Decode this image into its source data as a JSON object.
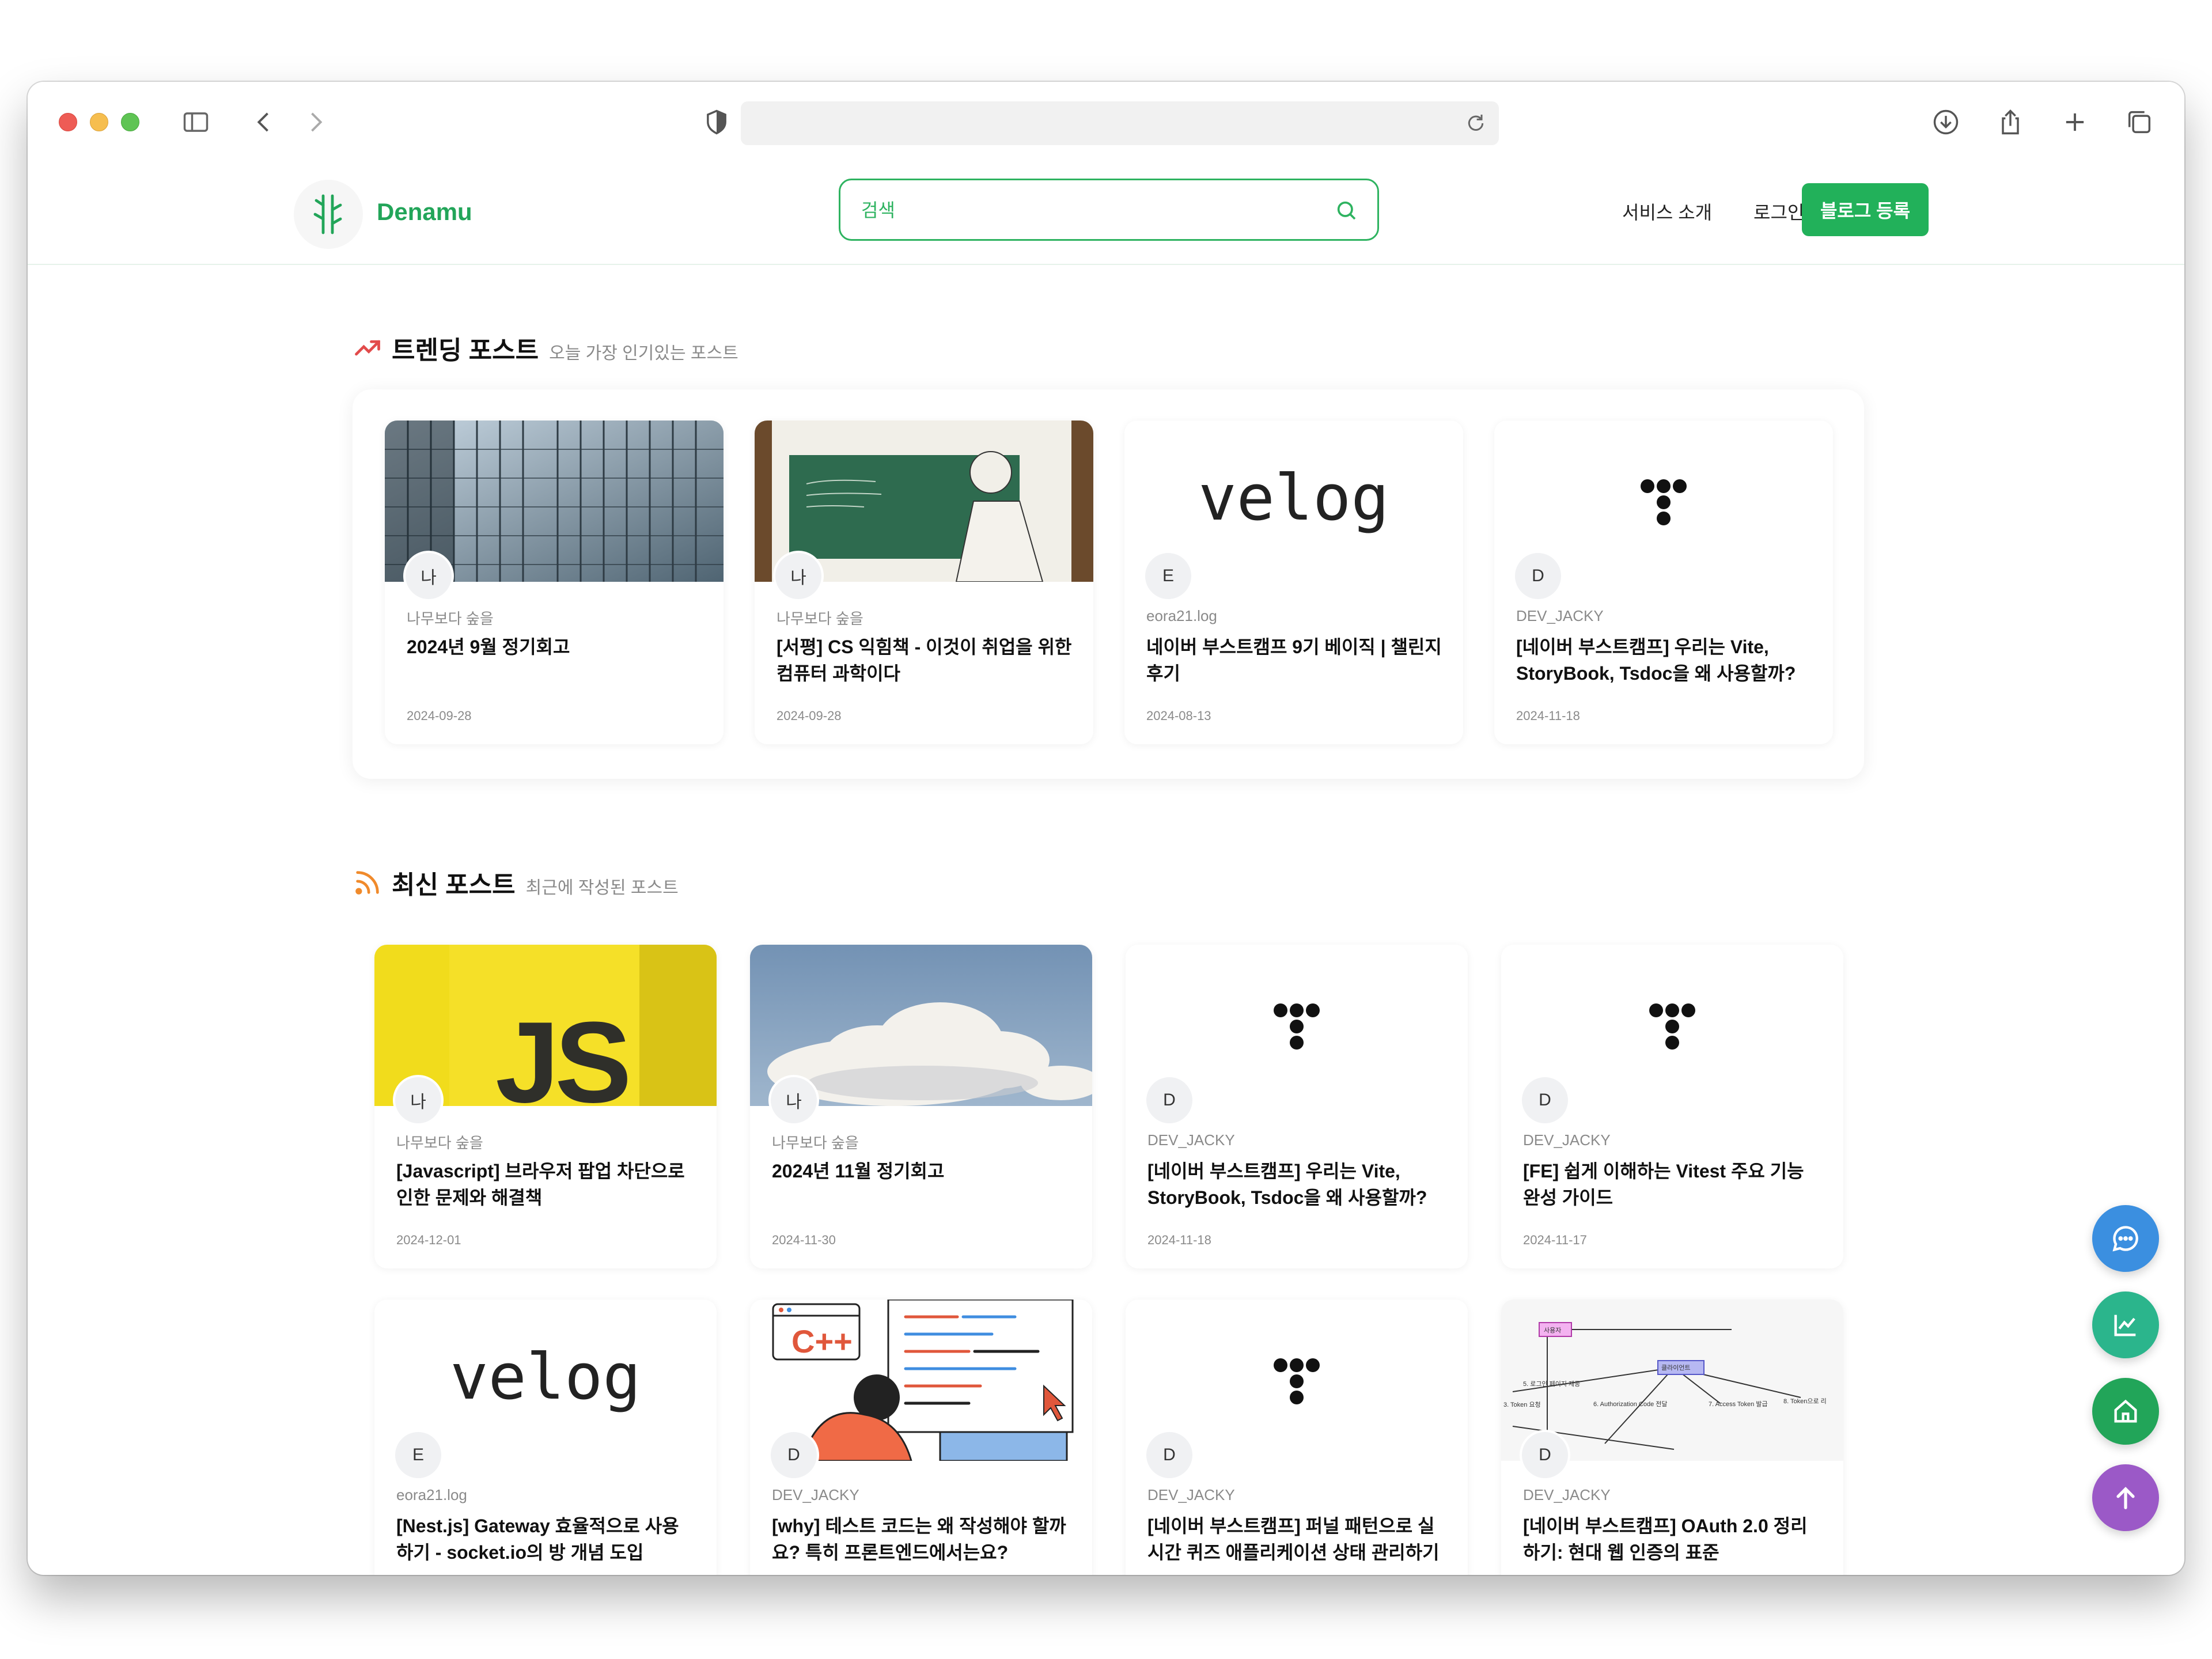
{
  "browser": {
    "address": "",
    "icons": [
      "sidebar-icon",
      "back-icon",
      "forward-icon",
      "shield-icon",
      "reload-icon",
      "download-icon",
      "share-icon",
      "new-tab-icon",
      "tabs-icon"
    ]
  },
  "header": {
    "logo_text": "Denamu",
    "search_placeholder": "검색",
    "nav_about": "서비스 소개",
    "nav_login": "로그인",
    "blog_register": "블로그 등록",
    "accent_color": "#22b15a"
  },
  "trending": {
    "title": "트렌딩 포스트",
    "subtitle": "오늘 가장 인기있는 포스트",
    "cards": [
      {
        "avatar": "나",
        "author": "나무보다 숲을",
        "title": "2024년 9월 정기회고",
        "date": "2024-09-28",
        "image": "building-photo"
      },
      {
        "avatar": "나",
        "author": "나무보다 숲을",
        "title": "[서평] CS 익힘책 - 이것이 취업을 위한 컴퓨터 과학이다",
        "date": "2024-09-28",
        "image": "book-cover"
      },
      {
        "avatar": "E",
        "author": "eora21.log",
        "title": "네이버 부스트캠프 9기 베이직 | 챌린지 후기",
        "date": "2024-08-13",
        "image": "velog-logo",
        "logo_text": "velog"
      },
      {
        "avatar": "D",
        "author": "DEV_JACKY",
        "title": "[네이버 부스트캠프] 우리는 Vite, StoryBook, Tsdoc을 왜 사용할까?",
        "date": "2024-11-18",
        "image": "tistory-logo"
      }
    ]
  },
  "latest": {
    "title": "최신 포스트",
    "subtitle": "최근에 작성된 포스트",
    "cards": [
      {
        "avatar": "나",
        "author": "나무보다 숲을",
        "title": "[Javascript] 브라우저 팝업 차단으로 인한 문제와 해결책",
        "date": "2024-12-01",
        "image": "js-logo",
        "logo_text": "JS"
      },
      {
        "avatar": "나",
        "author": "나무보다 숲을",
        "title": "2024년 11월 정기회고",
        "date": "2024-11-30",
        "image": "cloud-photo"
      },
      {
        "avatar": "D",
        "author": "DEV_JACKY",
        "title": "[네이버 부스트캠프] 우리는 Vite, StoryBook, Tsdoc을 왜 사용할까?",
        "date": "2024-11-18",
        "image": "tistory-logo"
      },
      {
        "avatar": "D",
        "author": "DEV_JACKY",
        "title": "[FE] 쉽게 이해하는 Vitest 주요 기능 완성 가이드",
        "date": "2024-11-17",
        "image": "tistory-logo"
      },
      {
        "avatar": "E",
        "author": "eora21.log",
        "title": "[Nest.js] Gateway 효율적으로 사용하기 - socket.io의 방 개념 도입",
        "date": "",
        "image": "velog-logo",
        "logo_text": "velog"
      },
      {
        "avatar": "D",
        "author": "DEV_JACKY",
        "title": "[why] 테스트 코드는 왜 작성해야 할까요? 특히 프론트엔드에서는요?",
        "date": "",
        "image": "cpp-illustration",
        "logo_text": "C++"
      },
      {
        "avatar": "D",
        "author": "DEV_JACKY",
        "title": "[네이버 부스트캠프] 퍼널 패턴으로 실시간 퀴즈 애플리케이션 상태 관리하기",
        "date": "",
        "image": "tistory-logo"
      },
      {
        "avatar": "D",
        "author": "DEV_JACKY",
        "title": "[네이버 부스트캠프] OAuth 2.0 정리하기: 현대 웹 인증의 표준",
        "date": "",
        "image": "oauth-diagram",
        "diagram_labels": [
          "사용자",
          "클라이언트",
          "5. 로그인 페이지 제공",
          "6. Authorization Code 전달",
          "7. Access Token 발급",
          "8. Token으로 리",
          "3. Token 요청"
        ]
      }
    ]
  },
  "fabs": [
    {
      "name": "chat-icon",
      "color": "#3b8fe0"
    },
    {
      "name": "chart-icon",
      "color": "#2bb58c"
    },
    {
      "name": "home-icon",
      "color": "#22a559"
    },
    {
      "name": "arrow-up-icon",
      "color": "#9b59c7"
    }
  ]
}
